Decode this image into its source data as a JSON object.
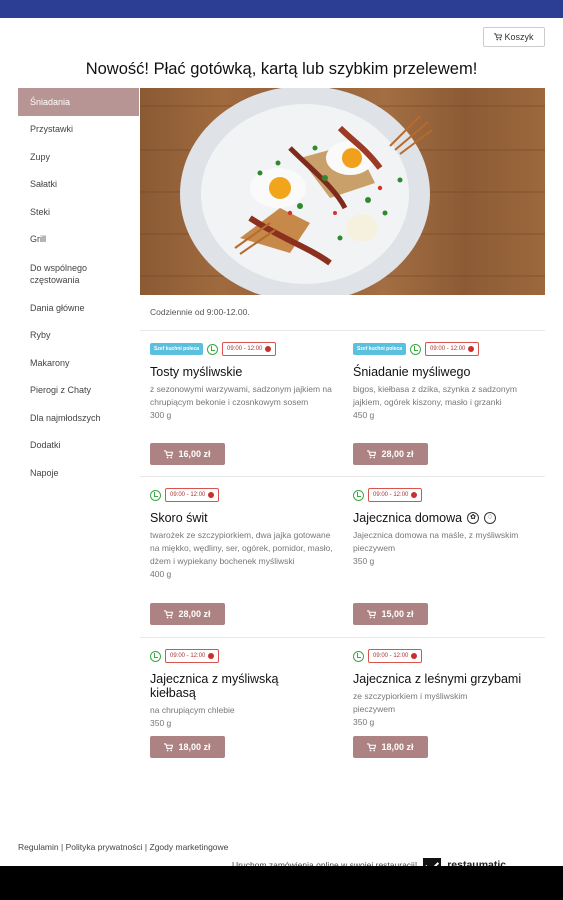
{
  "cart": {
    "label": "Koszyk"
  },
  "headline": "Nowość! Płać gotówką, kartą lub szybkim przelewem!",
  "sidebar": {
    "items": [
      {
        "label": "Śniadania",
        "active": true
      },
      {
        "label": "Przystawki"
      },
      {
        "label": "Zupy"
      },
      {
        "label": "Sałatki"
      },
      {
        "label": "Steki"
      },
      {
        "label": "Grill"
      },
      {
        "label": "Do wspólnego częstowania"
      },
      {
        "label": "Dania główne"
      },
      {
        "label": "Ryby"
      },
      {
        "label": "Makarony"
      },
      {
        "label": "Pierogi z Chaty"
      },
      {
        "label": "Dla najmłodszych"
      },
      {
        "label": "Dodatki"
      },
      {
        "label": "Napoje"
      }
    ]
  },
  "category": {
    "intro": "Codziennie od 9:00-12.00."
  },
  "badges": {
    "chef": "Szef kuchni poleca",
    "hours": "09:00 - 12:00"
  },
  "items": [
    {
      "name": "Tosty myśliwskie",
      "desc": "z sezonowymi warzywami, sadzonym jajkiem na chrupiącym bekonie i czosnkowym sosem",
      "weight": "300 g",
      "price": "16,00 zł"
    },
    {
      "name": "Śniadanie myśliwego",
      "desc": "bigos, kiełbasa z dzika, szynka z sadzonym jajkiem, ogórek kiszony, masło i grzanki",
      "weight": "450 g",
      "price": "28,00 zł"
    },
    {
      "name": "Skoro świt",
      "desc": "twarożek ze szczypiorkiem, dwa jajka gotowane na miękko, wędliny, ser, ogórek, pomidor, masło, dżem i wypiekany bochenek myśliwski",
      "weight": "400 g",
      "price": "28,00 zł"
    },
    {
      "name": "Jajecznica domowa",
      "desc": "Jajecznica domowa na maśle, z myśliwskim pieczywem",
      "weight": "350 g",
      "price": "15,00 zł"
    },
    {
      "name": "Jajecznica z myśliwską kiełbasą",
      "desc": "na chrupiącym chlebie",
      "weight": "350 g",
      "price": "18,00 zł"
    },
    {
      "name": "Jajecznica z leśnymi grzybami",
      "desc": "ze szczypiorkiem i myśliwskim pieczywem",
      "weight": "350 g",
      "price": "18,00 zł"
    }
  ],
  "footer": {
    "links": "Regulamin | Polityka prywatności | Zgody marketingowe",
    "tagline": "Uruchom zamówienia online w swojej restauracji!",
    "brand": "restaumatic"
  },
  "colors": {
    "topbar": "#2c3e94",
    "accent": "#ad8282",
    "active": "#b79595",
    "chef": "#5bc0de"
  }
}
